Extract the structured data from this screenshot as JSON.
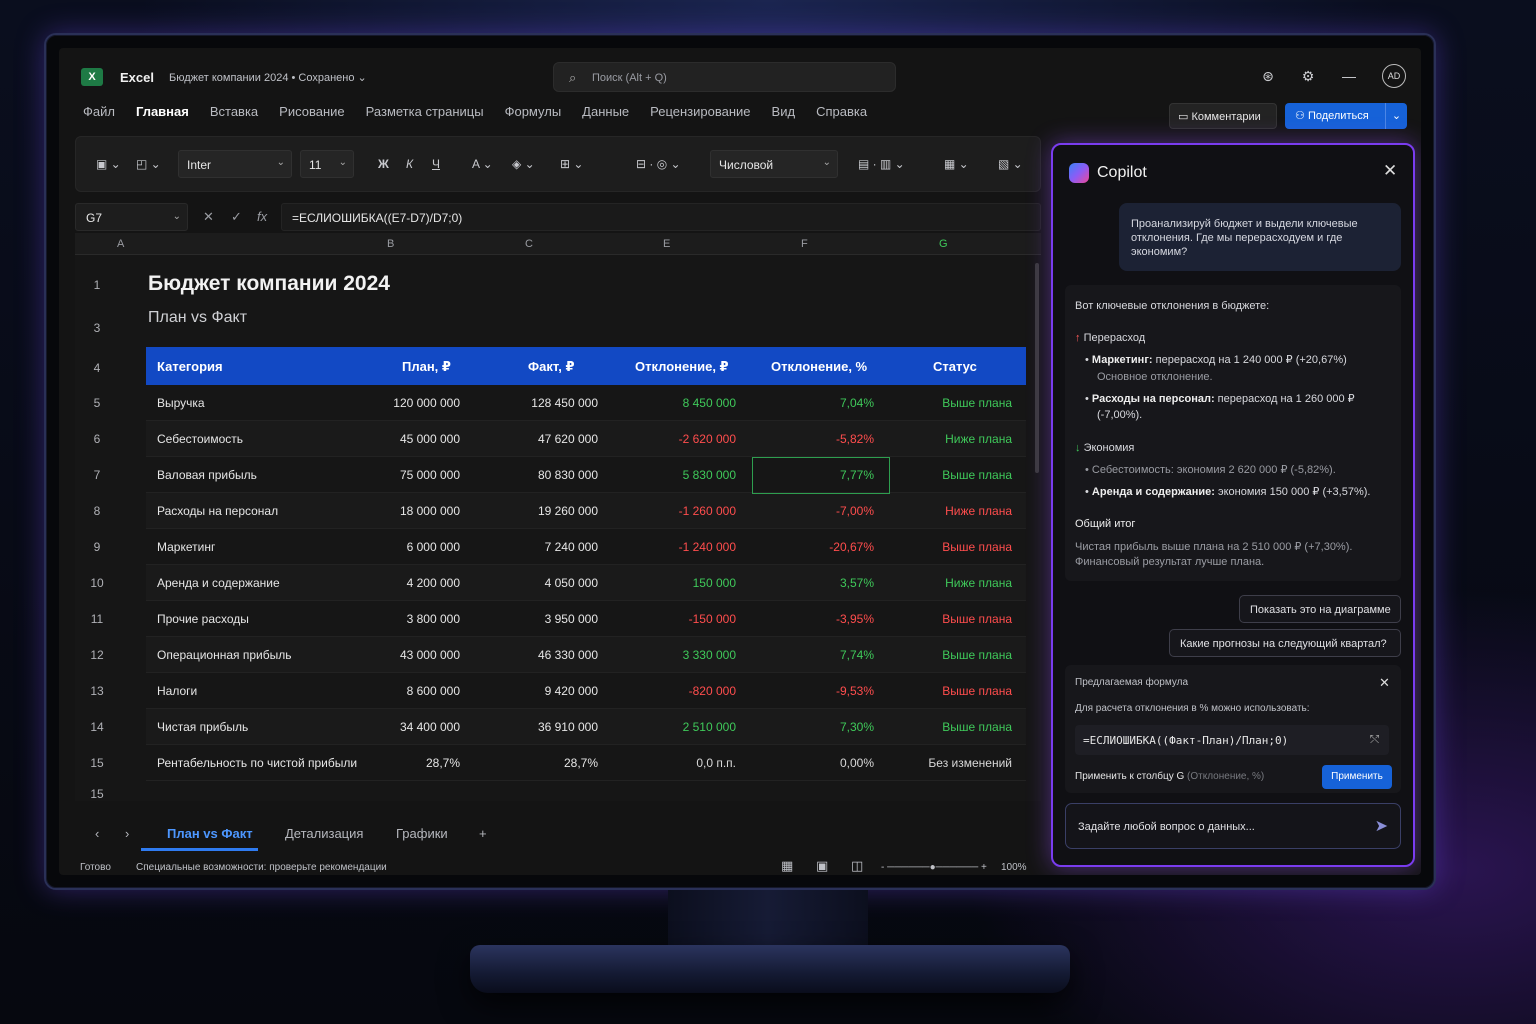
{
  "titlebar": {
    "app": "Excel",
    "doc": "Бюджет компании 2024 • Сохранено",
    "search": "Поиск (Alt + Q)",
    "avatar": "AD"
  },
  "menu": [
    "Файл",
    "Главная",
    "Вставка",
    "Рисование",
    "Разметка страницы",
    "Формулы",
    "Данные",
    "Рецензирование",
    "Вид",
    "Справка"
  ],
  "actions": {
    "comments": "Комментарии",
    "share": "Поделиться"
  },
  "ribbon": {
    "font": "Inter",
    "size": "11",
    "number_format": "Числовой",
    "bold": "Ж",
    "italic": "К",
    "underline": "Ч"
  },
  "formula_bar": {
    "cell": "G7",
    "formula": "=ЕСЛИОШИБКА((E7-D7)/D7;0)",
    "fx": "fx"
  },
  "columns": [
    "A",
    "B",
    "C",
    "E",
    "F",
    "G"
  ],
  "sheet": {
    "title": "Бюджет компании 2024",
    "subtitle": "План vs Факт",
    "headers": [
      "Категория",
      "План, ₽",
      "Факт, ₽",
      "Отклонение, ₽",
      "Отклонение, %",
      "Статус"
    ],
    "rows": [
      {
        "n": "5",
        "cat": "Выручка",
        "plan": "120 000 000",
        "fact": "128 450 000",
        "dev": "8 450 000",
        "pct": "7,04%",
        "status": "Выше плана"
      },
      {
        "n": "6",
        "cat": "Себестоимость",
        "plan": "45 000 000",
        "fact": "47 620 000",
        "dev": "-2 620 000",
        "pct": "-5,82%",
        "status": "Ниже плана"
      },
      {
        "n": "7",
        "cat": "Валовая прибыль",
        "plan": "75 000 000",
        "fact": "80 830 000",
        "dev": "5 830 000",
        "pct": "7,77%",
        "status": "Выше плана"
      },
      {
        "n": "8",
        "cat": "Расходы на персонал",
        "plan": "18 000 000",
        "fact": "19 260 000",
        "dev": "-1 260 000",
        "pct": "-7,00%",
        "status": "Ниже плана"
      },
      {
        "n": "9",
        "cat": "Маркетинг",
        "plan": "6 000 000",
        "fact": "7 240 000",
        "dev": "-1 240 000",
        "pct": "-20,67%",
        "status": "Выше плана"
      },
      {
        "n": "10",
        "cat": "Аренда и содержание",
        "plan": "4 200 000",
        "fact": "4 050 000",
        "dev": "150 000",
        "pct": "3,57%",
        "status": "Ниже плана"
      },
      {
        "n": "11",
        "cat": "Прочие расходы",
        "plan": "3 800 000",
        "fact": "3 950 000",
        "dev": "-150 000",
        "pct": "-3,95%",
        "status": "Выше плана"
      },
      {
        "n": "12",
        "cat": "Операционная прибыль",
        "plan": "43 000 000",
        "fact": "46 330 000",
        "dev": "3 330 000",
        "pct": "7,74%",
        "status": "Выше плана"
      },
      {
        "n": "13",
        "cat": "Налоги",
        "plan": "8 600 000",
        "fact": "9 420 000",
        "dev": "-820 000",
        "pct": "-9,53%",
        "status": "Выше плана"
      },
      {
        "n": "14",
        "cat": "Чистая прибыль",
        "plan": "34 400 000",
        "fact": "36 910 000",
        "dev": "2 510 000",
        "pct": "7,30%",
        "status": "Выше плана"
      },
      {
        "n": "15",
        "cat": "Рентабельность по чистой прибыли",
        "plan": "28,7%",
        "fact": "28,7%",
        "dev": "0,0 п.п.",
        "pct": "0,00%",
        "status": "Без изменений"
      }
    ],
    "colors": {
      "dev": [
        "pos",
        "neg",
        "pos",
        "neg",
        "neg",
        "pos",
        "neg",
        "pos",
        "neg",
        "pos",
        "neu"
      ],
      "pct": [
        "pos",
        "neg",
        "pos",
        "neg",
        "neg",
        "pos",
        "neg",
        "pos",
        "neg",
        "pos",
        "neu"
      ],
      "status": [
        "pos",
        "pos",
        "pos",
        "neg",
        "neg",
        "pos",
        "neg",
        "pos",
        "neg",
        "pos",
        "neu"
      ]
    }
  },
  "row_numbers": [
    "1",
    "3",
    "4",
    "15"
  ],
  "tabs": [
    "План vs Факт",
    "Детализация",
    "Графики",
    "+"
  ],
  "status": {
    "ready": "Готово",
    "a11y": "Специальные возможности: проверьте рекомендации",
    "zoom": "100%"
  },
  "copilot": {
    "title": "Copilot",
    "user_msg": "Проанализируй бюджет и выдели ключевые отклонения. Где мы перерасходуем и где экономим?",
    "intro": "Вот ключевые отклонения в бюджете:",
    "over_title": "Перерасход",
    "over1_b": "Маркетинг:",
    "over1": " перерасход на 1 240 000 ₽ (+20,67%)",
    "over1_note": "Основное отклонение.",
    "over2_b": "Расходы на персонал:",
    "over2": " перерасход на 1 260 000 ₽",
    "over2_pct": "(-7,00%).",
    "save_title": "Экономия",
    "save1": "Себестоимость: экономия 2 620 000 ₽ (-5,82%).",
    "save2_b": "Аренда и содержание:",
    "save2": " экономия 150 000 ₽ (+3,57%).",
    "total_title": "Общий итог",
    "total1": "Чистая прибыль выше плана на 2 510 000 ₽ (+7,30%).",
    "total2": "Финансовый результат лучше плана.",
    "suggestions": [
      "Показать это на диаграмме",
      "Какие прогнозы на следующий квартал?"
    ],
    "formula_card": {
      "title": "Предлагаемая формула",
      "desc": "Для расчета отклонения в % можно использовать:",
      "code": "=ЕСЛИОШИБКА((Факт-План)/План;0)",
      "apply_to": "Применить к столбцу G",
      "apply_to_hint": "(Отклонение, %)",
      "apply": "Применить"
    },
    "ask_placeholder": "Задайте любой вопрос о данных..."
  }
}
